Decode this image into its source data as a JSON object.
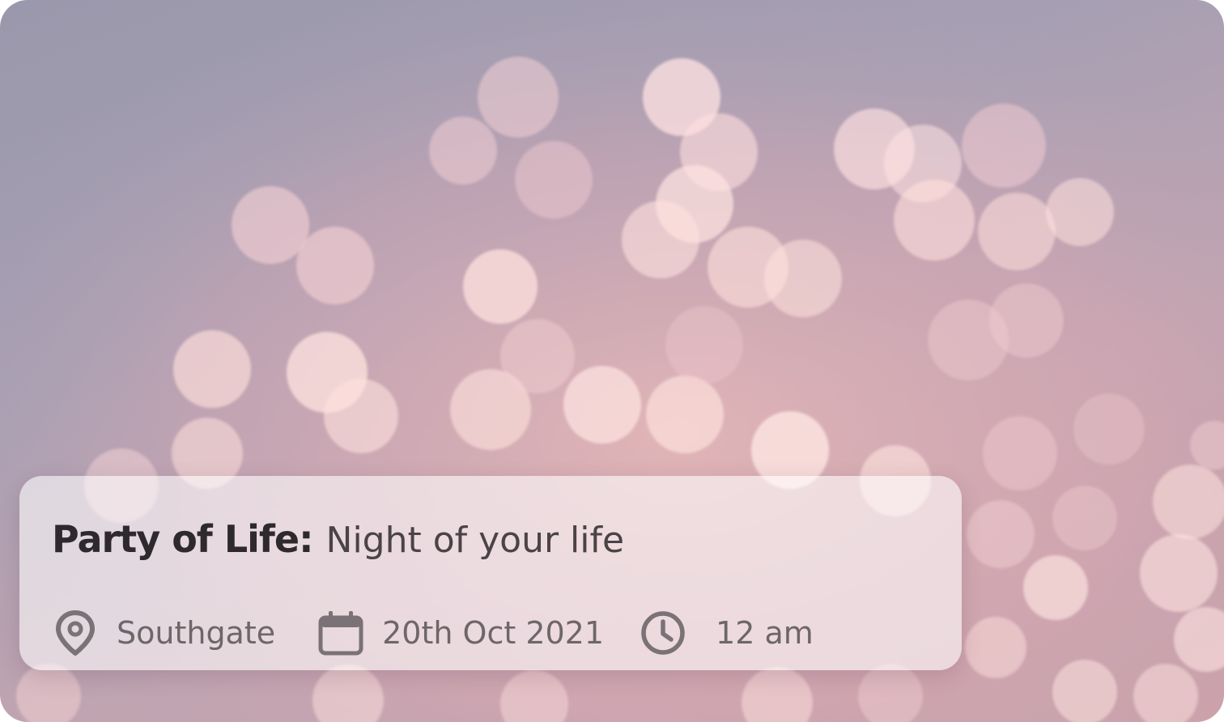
{
  "event": {
    "title_strong": "Party of Life:",
    "title_rest": "Night of your life",
    "location": "Southgate",
    "date": "20th Oct 2021",
    "time": "12 am"
  },
  "icons": {
    "location": "location-pin-icon",
    "date": "calendar-icon",
    "time": "clock-icon"
  },
  "colors": {
    "title": "#2e292c",
    "meta_text": "#6e6669",
    "icon": "#7a7276",
    "panel": "rgba(255,255,255,0.58)"
  }
}
